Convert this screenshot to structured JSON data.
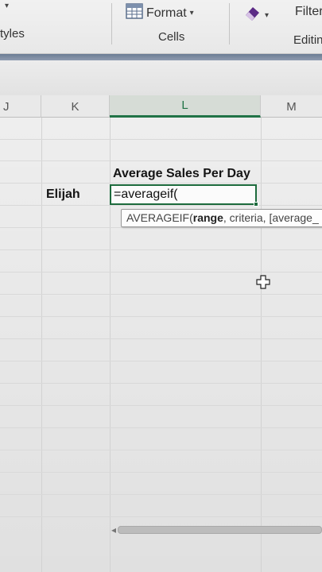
{
  "ribbon": {
    "styles_label": "tyles",
    "format_label": "Format",
    "cells_label": "Cells",
    "filter_label": "Filter",
    "editing_label": "Editin"
  },
  "columns": [
    "J",
    "K",
    "L",
    "M"
  ],
  "cells": {
    "title": "Average Sales Per Day",
    "name": "Elijah",
    "formula": "=averageif("
  },
  "tooltip": {
    "func": "AVERAGEIF(",
    "arg_active": "range",
    "rest": ", criteria, [average_"
  },
  "icons": {
    "format": "format-table-icon",
    "eraser": "eraser-icon",
    "cursor": "cell-select-cursor-icon"
  },
  "colors": {
    "accent": "#217346",
    "active_border": "#1d6b3d"
  }
}
